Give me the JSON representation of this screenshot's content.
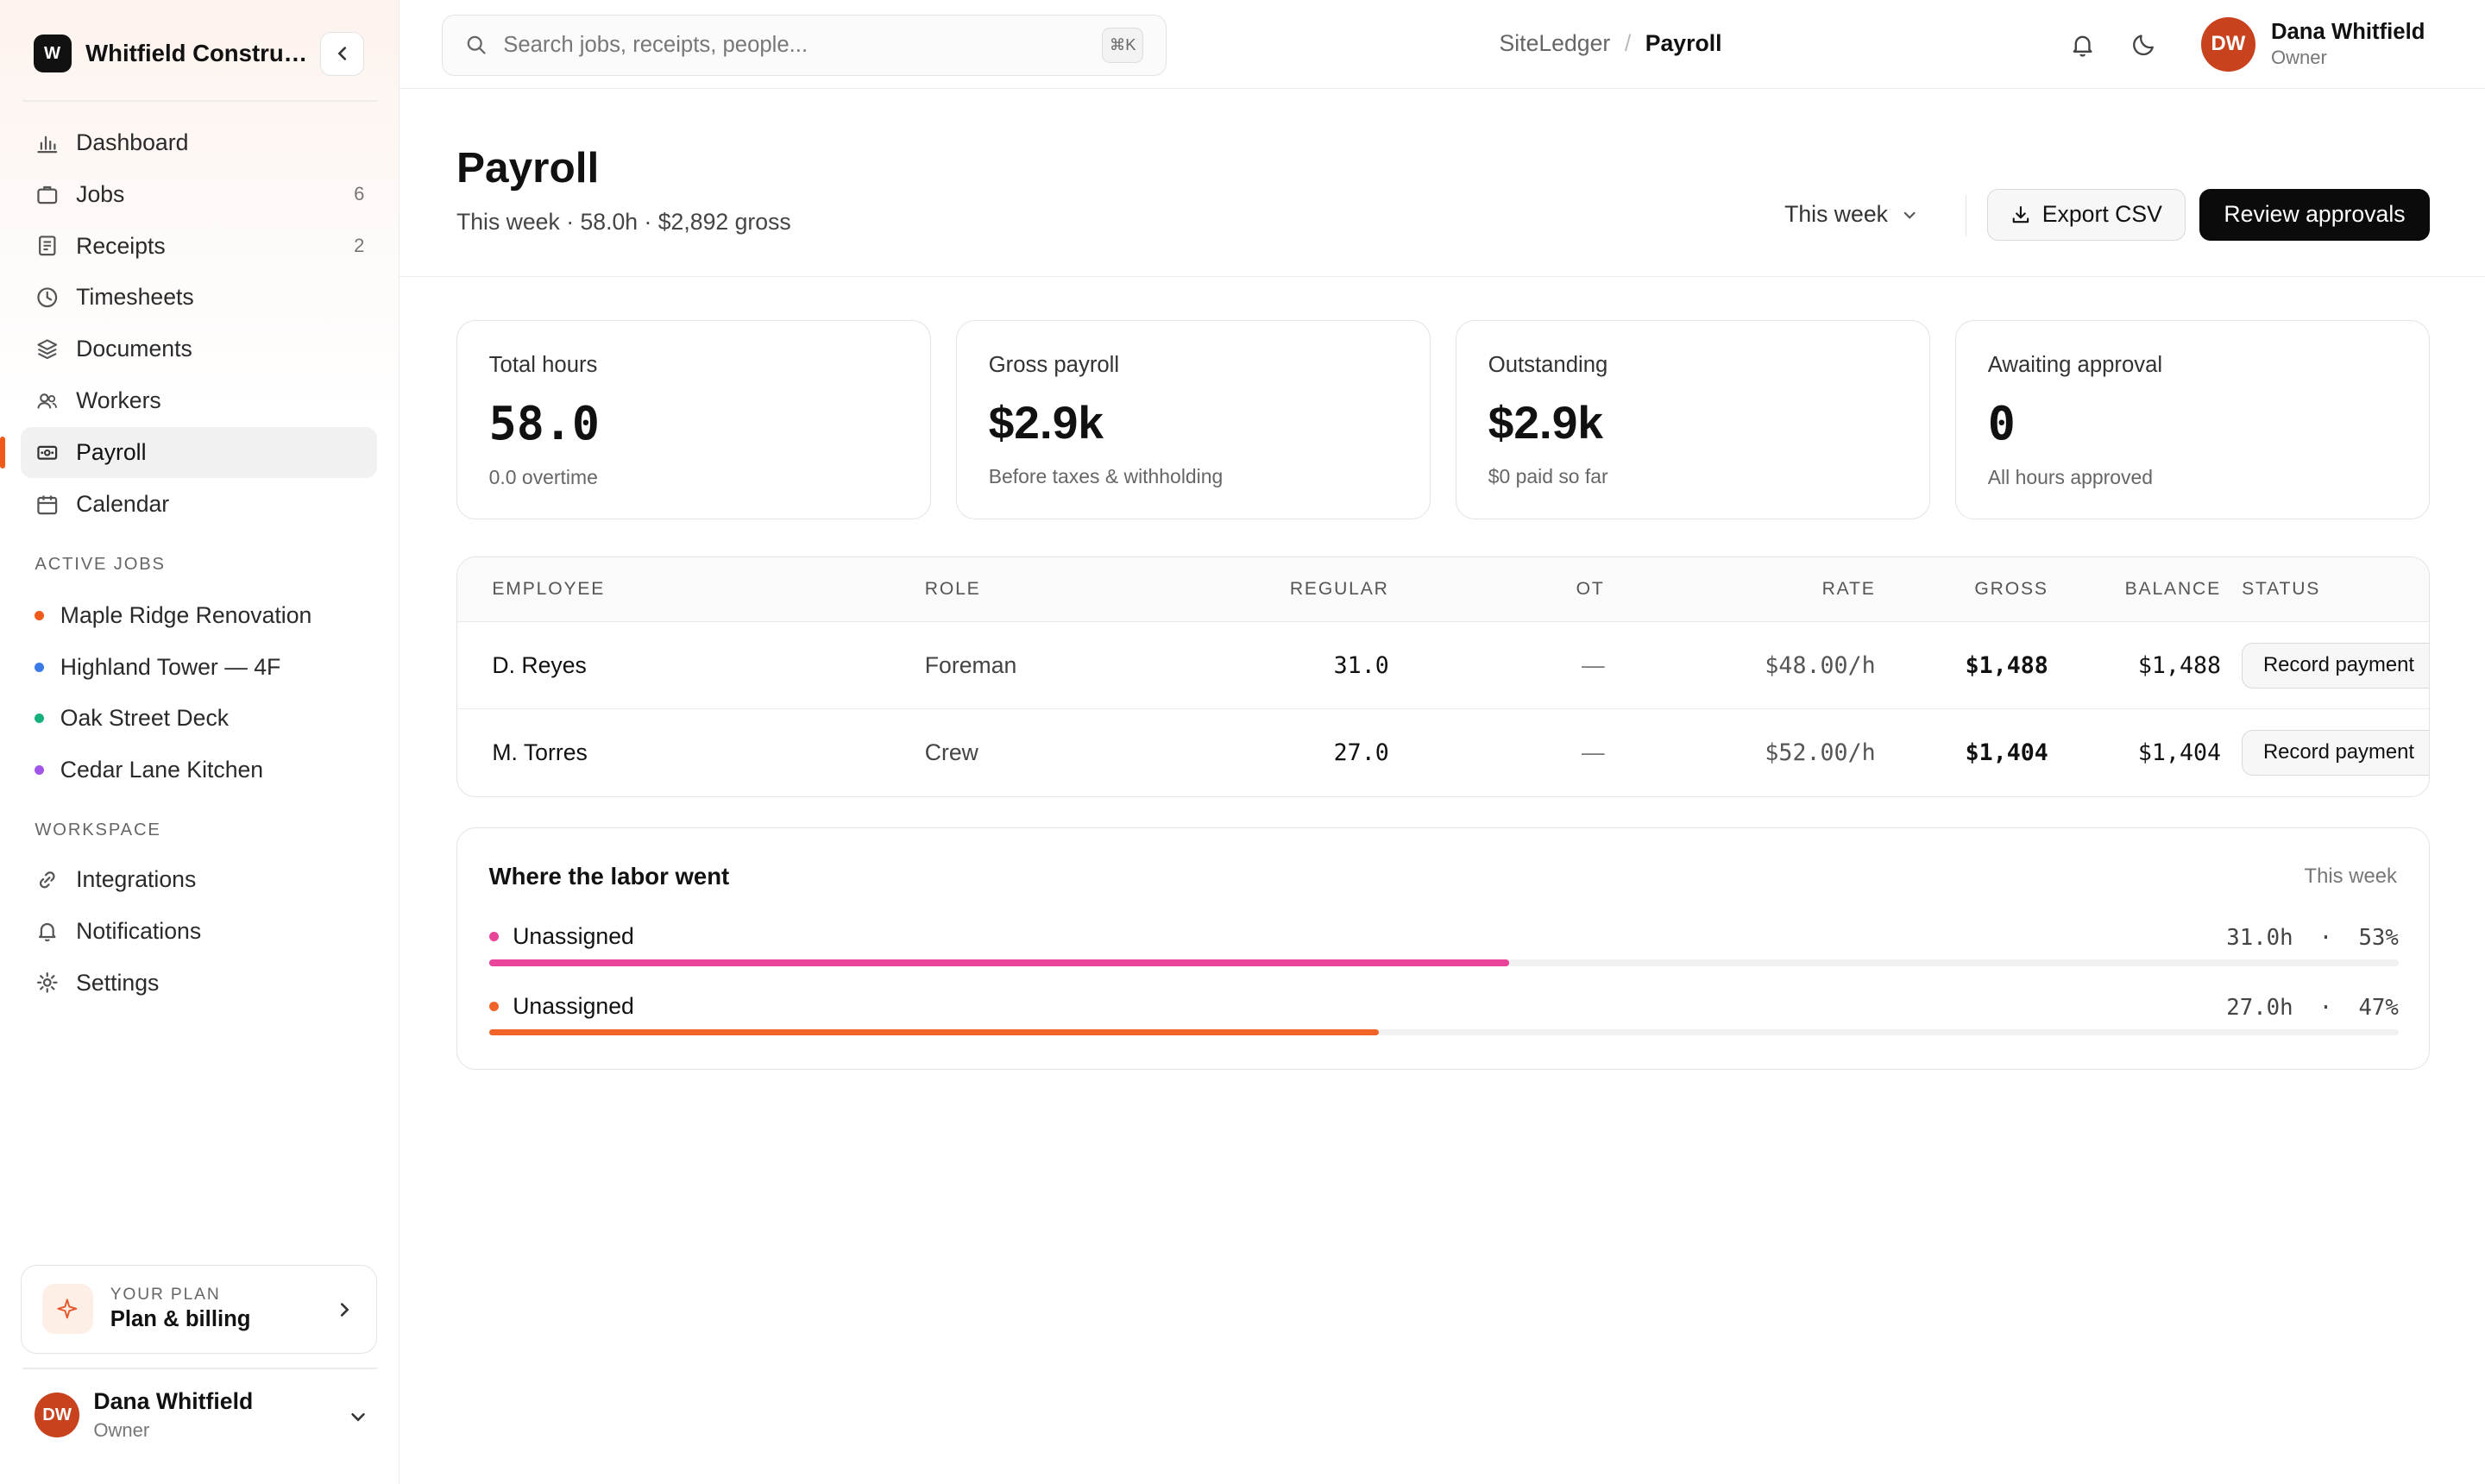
{
  "brand": {
    "logo_letter": "W",
    "name": "Whitfield Construc..."
  },
  "nav": [
    {
      "label": "Dashboard",
      "icon": "chart-icon",
      "count": ""
    },
    {
      "label": "Jobs",
      "icon": "briefcase-icon",
      "count": "6"
    },
    {
      "label": "Receipts",
      "icon": "receipt-icon",
      "count": "2"
    },
    {
      "label": "Timesheets",
      "icon": "clock-icon",
      "count": ""
    },
    {
      "label": "Documents",
      "icon": "layers-icon",
      "count": ""
    },
    {
      "label": "Workers",
      "icon": "users-icon",
      "count": ""
    },
    {
      "label": "Payroll",
      "icon": "banknote-icon",
      "count": "",
      "active": true
    },
    {
      "label": "Calendar",
      "icon": "calendar-icon",
      "count": ""
    }
  ],
  "active_jobs": {
    "title": "ACTIVE JOBS",
    "items": [
      {
        "label": "Maple Ridge Renovation",
        "color": "#f05a1a"
      },
      {
        "label": "Highland Tower — 4F",
        "color": "#3b7be8"
      },
      {
        "label": "Oak Street Deck",
        "color": "#16b07a"
      },
      {
        "label": "Cedar Lane Kitchen",
        "color": "#a055e8"
      }
    ]
  },
  "workspace": {
    "title": "WORKSPACE",
    "items": [
      {
        "label": "Integrations",
        "icon": "link-icon"
      },
      {
        "label": "Notifications",
        "icon": "bell-icon"
      },
      {
        "label": "Settings",
        "icon": "gear-icon"
      }
    ]
  },
  "plan": {
    "kicker": "YOUR PLAN",
    "title": "Plan & billing"
  },
  "user": {
    "initials": "DW",
    "name": "Dana Whitfield",
    "role": "Owner"
  },
  "search": {
    "placeholder": "Search jobs, receipts, people...",
    "shortcut": "⌘K"
  },
  "breadcrumb": {
    "root": "SiteLedger",
    "separator": "/",
    "current": "Payroll"
  },
  "page": {
    "title": "Payroll",
    "subtitle": "This week · 58.0h · $2,892 gross",
    "period": "This week",
    "export_label": "Export CSV",
    "review_label": "Review approvals"
  },
  "stats": [
    {
      "label": "Total hours",
      "value": "58.0",
      "note": "0.0 overtime",
      "mono": true
    },
    {
      "label": "Gross payroll",
      "value": "$2.9k",
      "note": "Before taxes & withholding",
      "mono": false
    },
    {
      "label": "Outstanding",
      "value": "$2.9k",
      "note": "$0 paid so far",
      "mono": false
    },
    {
      "label": "Awaiting approval",
      "value": "0",
      "note": "All hours approved",
      "mono": true
    }
  ],
  "table": {
    "columns": [
      "EMPLOYEE",
      "ROLE",
      "REGULAR",
      "OT",
      "RATE",
      "GROSS",
      "BALANCE",
      "STATUS"
    ],
    "rows": [
      {
        "employee": "D. Reyes",
        "role": "Foreman",
        "regular": "31.0",
        "ot": "—",
        "rate": "$48.00/h",
        "gross": "$1,488",
        "balance": "$1,488",
        "action": "Record payment"
      },
      {
        "employee": "M. Torres",
        "role": "Crew",
        "regular": "27.0",
        "ot": "—",
        "rate": "$52.00/h",
        "gross": "$1,404",
        "balance": "$1,404",
        "action": "Record payment"
      }
    ]
  },
  "labor": {
    "title": "Where the labor went",
    "period": "This week",
    "rows": [
      {
        "label": "Unassigned",
        "hours": "31.0h",
        "pct": "53%",
        "fraction": 0.534,
        "color": "#e8459a"
      },
      {
        "label": "Unassigned",
        "hours": "27.0h",
        "pct": "47%",
        "fraction": 0.466,
        "color": "#f0642a"
      }
    ]
  }
}
